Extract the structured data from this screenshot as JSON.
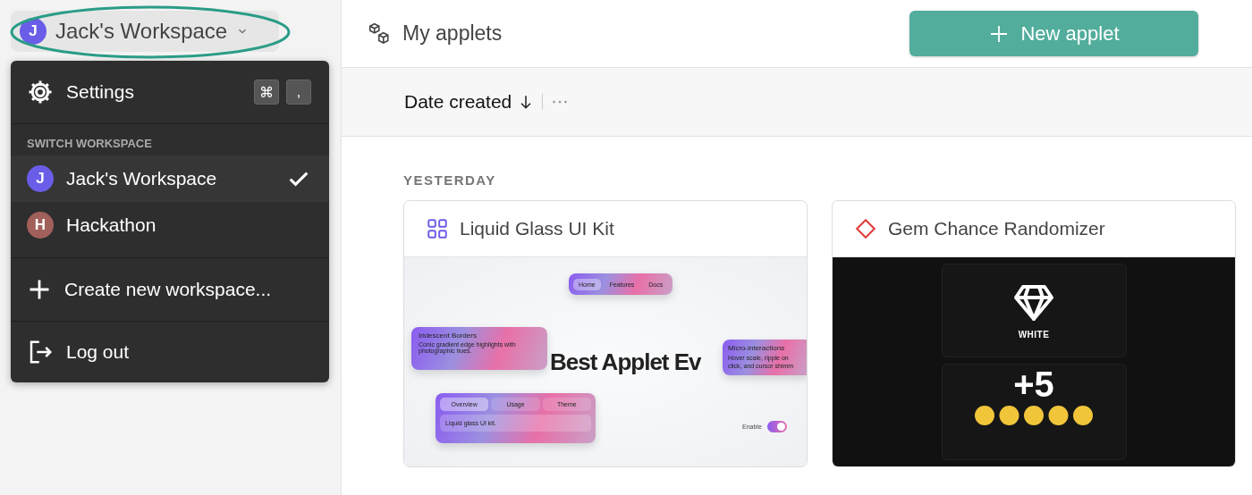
{
  "workspace_button": {
    "initial": "J",
    "label": "Jack's Workspace"
  },
  "menu": {
    "settings": {
      "label": "Settings",
      "shortcut": [
        "⌘",
        ","
      ]
    },
    "section_label": "SWITCH WORKSPACE",
    "workspaces": [
      {
        "initial": "J",
        "name": "Jack's Workspace",
        "color": "#6a5de8",
        "selected": true
      },
      {
        "initial": "H",
        "name": "Hackathon",
        "color": "#a2605a",
        "selected": false
      }
    ],
    "create": "Create new workspace...",
    "logout": "Log out"
  },
  "header": {
    "title": "My applets",
    "new_button": "New applet"
  },
  "sort": {
    "label": "Date created"
  },
  "groups": [
    {
      "label": "YESTERDAY",
      "applets": [
        {
          "kind": "ui-kit",
          "title": "Liquid Glass UI Kit",
          "preview": {
            "nav": [
              {
                "label": "Home",
                "selected": true
              },
              {
                "label": "Features",
                "selected": false
              },
              {
                "label": "Docs",
                "selected": false
              }
            ],
            "headline": "Best Applet Ev",
            "card_1": {
              "title": "Iridescent Borders",
              "text": "Conic gradient edge highlights with photographic hues."
            },
            "card_2": {
              "title": "Micro-interactions",
              "text": "Hover scale, ripple on click, and cursor shimm"
            },
            "tabs": [
              {
                "label": "Overview",
                "selected": true
              },
              {
                "label": "Usage",
                "selected": false
              },
              {
                "label": "Theme",
                "selected": false
              }
            ],
            "panel_text": "Liquid glass UI kit.",
            "toggle": {
              "label": "Enable",
              "on": true
            }
          }
        },
        {
          "kind": "gem",
          "title": "Gem Chance Randomizer",
          "preview": {
            "gem_label": "WHITE",
            "amount": "+5"
          }
        }
      ]
    }
  ]
}
